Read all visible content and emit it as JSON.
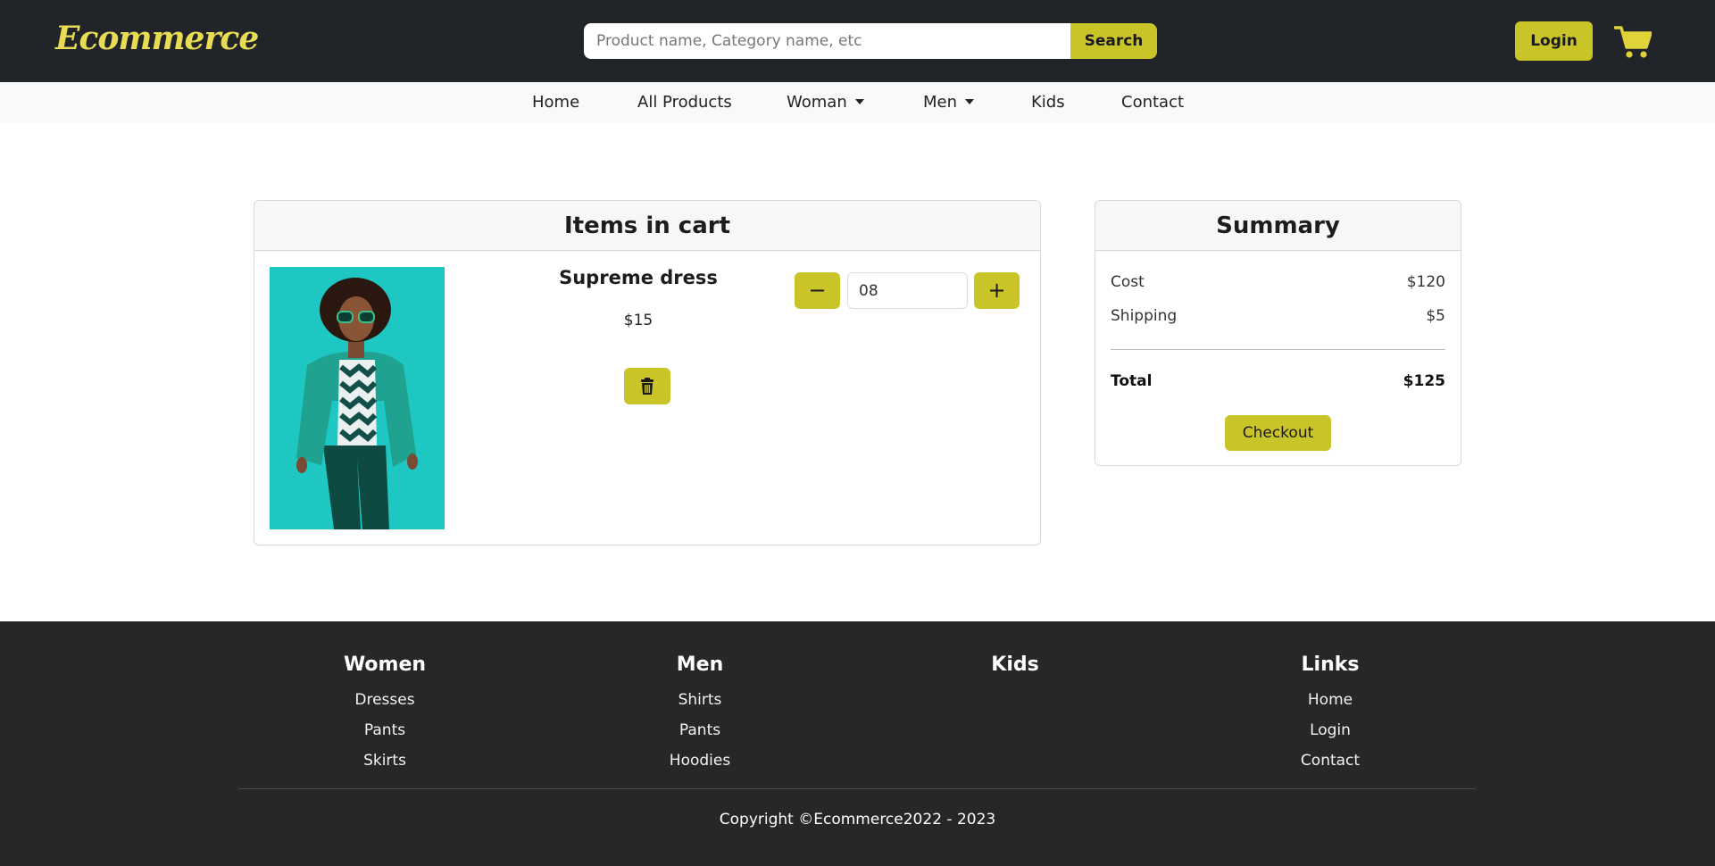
{
  "header": {
    "logo": "Ecommerce",
    "search_placeholder": "Product name, Category name, etc",
    "search_label": "Search",
    "login_label": "Login",
    "cart_icon": "cart-icon"
  },
  "nav": {
    "items": [
      {
        "label": "Home"
      },
      {
        "label": "All Products"
      },
      {
        "label": "Woman",
        "dropdown": true
      },
      {
        "label": "Men",
        "dropdown": true
      },
      {
        "label": "Kids"
      },
      {
        "label": "Contact"
      }
    ]
  },
  "cart": {
    "title": "Items in cart",
    "item": {
      "name": "Supreme dress",
      "price": "$15",
      "quantity": "08",
      "delete_icon": "trash-icon",
      "minus_label": "−",
      "plus_label": "+"
    }
  },
  "summary": {
    "title": "Summary",
    "cost_label": "Cost",
    "cost_value": "$120",
    "shipping_label": "Shipping",
    "shipping_value": "$5",
    "total_label": "Total",
    "total_value": "$125",
    "checkout_label": "Checkout"
  },
  "footer": {
    "columns": [
      {
        "title": "Women",
        "links": [
          "Dresses",
          "Pants",
          "Skirts"
        ]
      },
      {
        "title": "Men",
        "links": [
          "Shirts",
          "Pants",
          "Hoodies"
        ]
      },
      {
        "title": "Kids",
        "links": []
      },
      {
        "title": "Links",
        "links": [
          "Home",
          "Login",
          "Contact"
        ]
      }
    ],
    "copyright": "Copyright ©Ecommerce2022 - 2023"
  },
  "colors": {
    "accent": "#c9c428",
    "header_bg": "#212429",
    "footer_bg": "#272727",
    "logo": "#e8dc52"
  }
}
